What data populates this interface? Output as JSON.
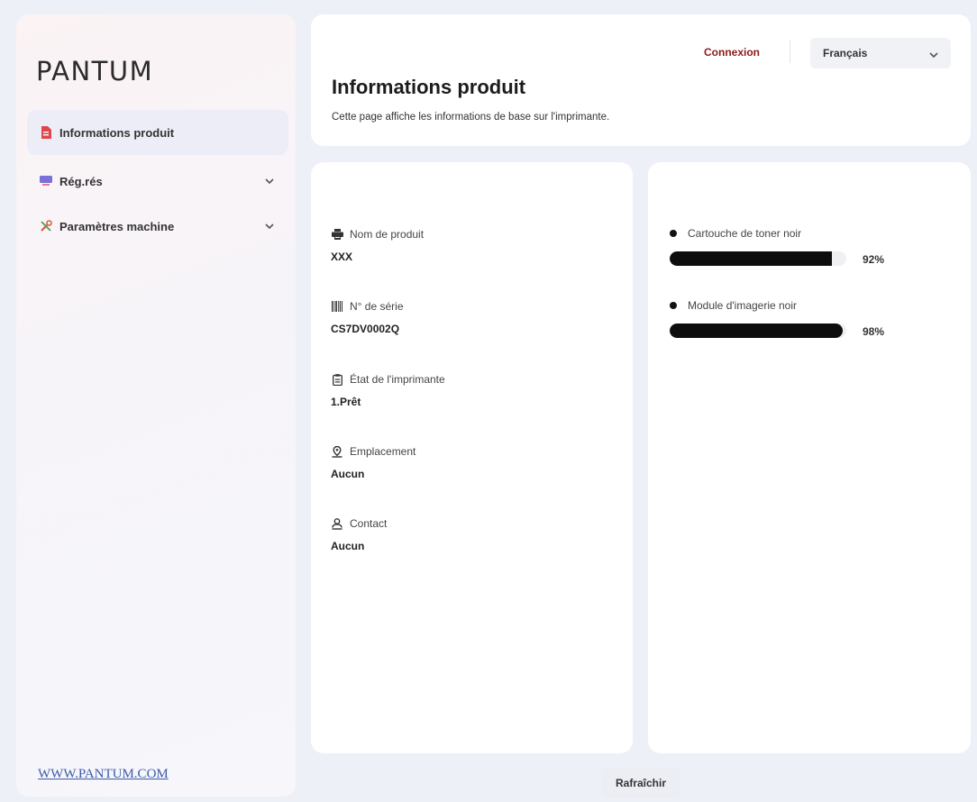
{
  "brand": {
    "logo": "PANTUM",
    "footer_link": "WWW.PANTUM.COM"
  },
  "sidebar": {
    "items": [
      {
        "label": "Informations produit",
        "icon": "document-icon",
        "active": true
      },
      {
        "label": "Rég.rés",
        "icon": "network-icon",
        "expandable": true
      },
      {
        "label": "Paramètres machine",
        "icon": "tools-icon",
        "expandable": true
      }
    ]
  },
  "header": {
    "login_label": "Connexion",
    "language": {
      "selected": "Français"
    },
    "title": "Informations produit",
    "description": "Cette page affiche les informations de base sur l'imprimante."
  },
  "product": {
    "fields": [
      {
        "label": "Nom de produit",
        "value": "XXX",
        "icon": "printer-icon"
      },
      {
        "label": "N° de série",
        "value": "CS7DV0002Q",
        "icon": "barcode-icon"
      },
      {
        "label": "État de l'imprimante",
        "value": "1.Prêt",
        "icon": "clipboard-icon"
      },
      {
        "label": "Emplacement",
        "value": "Aucun",
        "icon": "location-pin-icon"
      },
      {
        "label": "Contact",
        "value": "Aucun",
        "icon": "person-icon"
      }
    ]
  },
  "supplies": [
    {
      "label": "Cartouche de toner noir",
      "percent_text": "92%",
      "level": 0.92
    },
    {
      "label": "Module d'imagerie noir",
      "percent_text": "98%",
      "level": 0.98
    }
  ],
  "actions": {
    "refresh_label": "Rafraîchir"
  },
  "colors": {
    "accent": "#8b1a1a",
    "bar_fill": "#0d0d0d",
    "link": "#3b5ba8"
  }
}
